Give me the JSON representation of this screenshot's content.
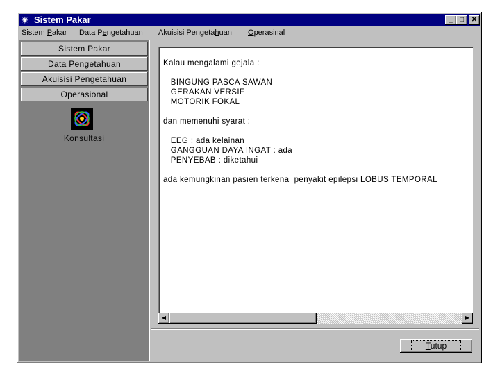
{
  "window": {
    "title": "Sistem Pakar",
    "title_icon": "star-burst-icon"
  },
  "controls": {
    "minimize": "_",
    "maximize": "□",
    "close": "✕"
  },
  "menu": [
    {
      "pre": "Sistem ",
      "ul": "P",
      "post": "akar"
    },
    {
      "pre": "Data P",
      "ul": "e",
      "post": "ngetahuan"
    },
    {
      "pre": "Akuisisi Pengeta",
      "ul": "h",
      "post": "uan"
    },
    {
      "pre": "",
      "ul": "O",
      "post": "perasinal"
    }
  ],
  "sidebar": {
    "buttons": [
      "Sistem Pakar",
      "Data Pengetahuan",
      "Akuisisi Pengetahuan",
      "Operasional"
    ],
    "item_label": "Konsultasi"
  },
  "result": {
    "lines": [
      "Kalau mengalami gejala :",
      "",
      "   BINGUNG PASCA SAWAN",
      "   GERAKAN VERSIF",
      "   MOTORIK FOKAL",
      "",
      "dan memenuhi syarat :",
      "",
      "   EEG : ada kelainan",
      "   GANGGUAN DAYA INGAT : ada",
      "   PENYEBAB : diketahui",
      "",
      "ada kemungkinan pasien terkena  penyakit epilepsi LOBUS TEMPORAL"
    ]
  },
  "scrollbar": {
    "left_arrow": "◀",
    "right_arrow": "▶"
  },
  "footer": {
    "close_button": {
      "ul": "T",
      "post": "utup"
    }
  }
}
